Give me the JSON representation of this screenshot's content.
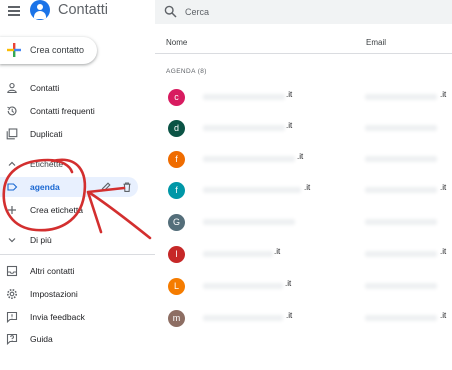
{
  "app": {
    "title": "Contatti"
  },
  "sidebar": {
    "create_label": "Crea contatto",
    "items": [
      {
        "label": "Contatti",
        "icon": "person-icon"
      },
      {
        "label": "Contatti frequenti",
        "icon": "history-icon"
      },
      {
        "label": "Duplicati",
        "icon": "duplicates-icon"
      }
    ],
    "labels_header": "Etichette",
    "agenda": {
      "label": "agenda"
    },
    "create_label_item": "Crea etichetta",
    "more": "Di più",
    "bottom_items": [
      {
        "label": "Altri contatti",
        "icon": "inbox-icon"
      },
      {
        "label": "Impostazioni",
        "icon": "gear-icon"
      },
      {
        "label": "Invia feedback",
        "icon": "feedback-icon"
      },
      {
        "label": "Guida",
        "icon": "help-icon"
      }
    ]
  },
  "search": {
    "placeholder": "Cerca",
    "value": ""
  },
  "table": {
    "columns": [
      "Nome",
      "Email"
    ],
    "section": "AGENDA (8)",
    "rows": [
      {
        "initial": "c",
        "color": "#d81b60",
        "name_domain": ".it",
        "email_domain": ".it"
      },
      {
        "initial": "d",
        "color": "#0b5345",
        "name_domain": ".it",
        "email_domain": ""
      },
      {
        "initial": "f",
        "color": "#ef6c00",
        "name_domain": ".it",
        "email_domain": ""
      },
      {
        "initial": "f",
        "color": "#0097a7",
        "name_domain": ".it",
        "email_domain": ".it"
      },
      {
        "initial": "G",
        "color": "#546e7a",
        "name_domain": "",
        "email_domain": ""
      },
      {
        "initial": "l",
        "color": "#c62828",
        "name_domain": ".it",
        "email_domain": ".it"
      },
      {
        "initial": "L",
        "color": "#f57c00",
        "name_domain": ".it",
        "email_domain": ""
      },
      {
        "initial": "m",
        "color": "#8d6e63",
        "name_domain": ".it",
        "email_domain": ".it"
      }
    ]
  },
  "colors": {
    "accent": "#1a73e8",
    "selected_bg": "#e8f0fe",
    "annotation": "#d32f2f"
  }
}
